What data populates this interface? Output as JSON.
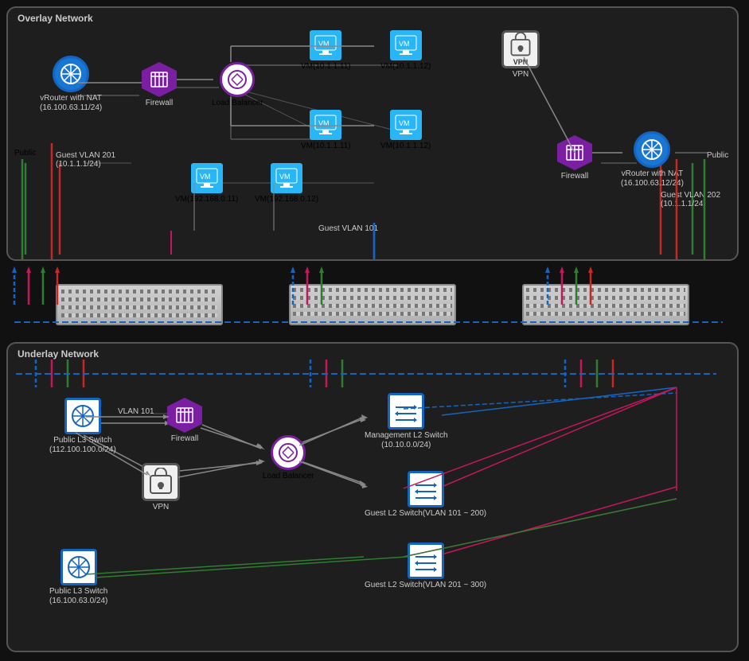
{
  "overlay": {
    "label": "Overlay Network",
    "vrouter_left": {
      "label": "vRouter with NAT",
      "sub": "(16.100.63.11/24)"
    },
    "firewall_left": {
      "label": "Firewall"
    },
    "lb_top": {
      "label": "Load Balancer"
    },
    "vm1": {
      "label": "VM(10.1.1.11)"
    },
    "vm2": {
      "label": "VM(10.1.1.12)"
    },
    "vm3": {
      "label": "VM(10.1.1.11)"
    },
    "vm4": {
      "label": "VM(10.1.1.12)"
    },
    "vm5": {
      "label": "VM(192.168.0.11)"
    },
    "vm6": {
      "label": "VM(192.168.0.12)"
    },
    "vpn": {
      "label": "VPN"
    },
    "firewall_right": {
      "label": "Firewall"
    },
    "vrouter_right": {
      "label": "vRouter with NAT",
      "sub": "(16.100.63.12/24)"
    },
    "guest_vlan_left": {
      "label": "Guest VLAN 201",
      "sub": "(10.1.1.1/24)"
    },
    "guest_vlan_mid": {
      "label": "Guest VLAN 101"
    },
    "guest_vlan_right": {
      "label": "Guest VLAN 202",
      "sub": "(10.1.1.1/24)"
    },
    "public_left": {
      "label": "Public"
    },
    "public_right": {
      "label": "Public"
    }
  },
  "underlay": {
    "label": "Underlay Network",
    "firewall": {
      "label": "Firewall"
    },
    "lb": {
      "label": "Load Balancer"
    },
    "vpn": {
      "label": "VPN"
    },
    "public_l3_top": {
      "label": "Public L3 Switch",
      "sub": "(112.100.100.0/24)"
    },
    "public_l3_bot": {
      "label": "Public L3 Switch",
      "sub": "(16.100.63.0/24)"
    },
    "mgmt_l2": {
      "label": "Management L2 Switch",
      "sub": "(10.10.0.0/24)"
    },
    "guest_l2_top": {
      "label": "Guest L2 Switch(VLAN 101 ~ 200)"
    },
    "guest_l2_bot": {
      "label": "Guest L2 Switch(VLAN 201 ~ 300)"
    },
    "vlan101": {
      "label": "VLAN 101"
    }
  },
  "colors": {
    "green": "#2E7D32",
    "red": "#C62828",
    "blue": "#1565C0",
    "pink": "#C2185B",
    "purple": "#7B1FA2",
    "cyan": "#0097A7",
    "dashed_blue": "#1565C0"
  }
}
